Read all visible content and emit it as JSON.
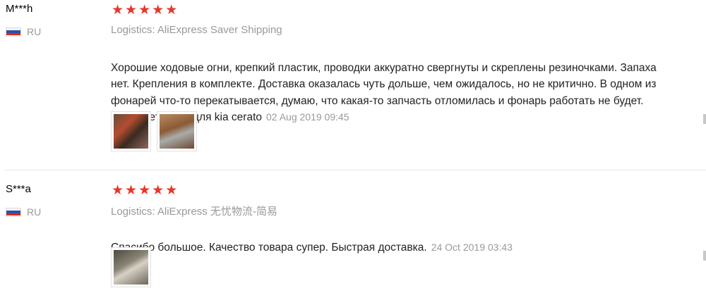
{
  "reviews": [
    {
      "user": "M***h",
      "country": "RU",
      "logistics": "Logistics: AliExpress Saver Shipping",
      "text": "Хорошие ходовые огни, крепкий пластик, проводки аккуратно свергнуты и скреплены резиночками. Запаха\nнет. Крепления в комплекте. Доставка оказалась чуть дольше, чем ожидалось, но не критично. В одном из\nфонарей что-то перекатывается, думаю, что какая-то запчасть отломилась и фонарь работать не будет.\nПриобретались для kia cerato",
      "date": "02 Aug 2019 09:45"
    },
    {
      "user": "S***a",
      "country": "RU",
      "logistics": "Logistics: AliExpress 无忧物流-简易",
      "text": "Спасибо большое. Качество товара супер. Быстрая доставка.",
      "date": "24 Oct 2019 03:43"
    }
  ],
  "colors": {
    "star": "#e8372a",
    "muted": "#999999"
  },
  "icons": {
    "star": "star-icon",
    "flag": "russia-flag-icon"
  }
}
